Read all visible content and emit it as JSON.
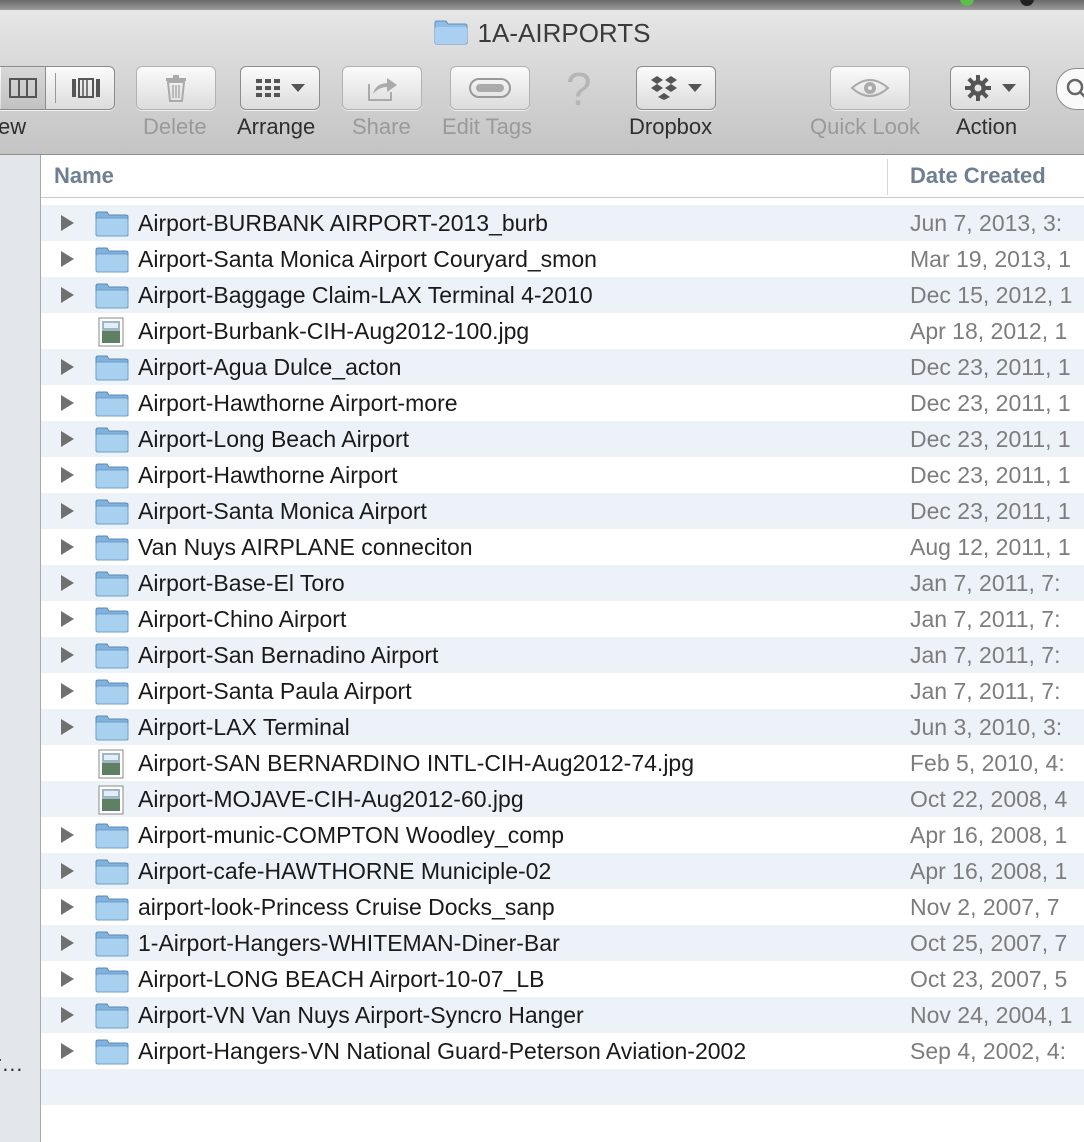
{
  "window": {
    "title": "1A-AIRPORTS"
  },
  "toolbar": {
    "view_label_partial": "ew",
    "delete_label": "Delete",
    "arrange_label": "Arrange",
    "share_label": "Share",
    "edit_tags_label": "Edit Tags",
    "help_glyph": "?",
    "dropbox_label": "Dropbox",
    "quick_look_label": "Quick Look",
    "action_label": "Action"
  },
  "sidebar": {
    "truncated_item": "r…"
  },
  "columns": {
    "name": "Name",
    "date_created": "Date Created"
  },
  "files": [
    {
      "name": "Airport-BURBANK AIRPORT-2013_burb",
      "date": "Jun 7, 2013, 3:",
      "type": "folder"
    },
    {
      "name": "Airport-Santa Monica Airport Couryard_smon",
      "date": "Mar 19, 2013, 1",
      "type": "folder"
    },
    {
      "name": "Airport-Baggage Claim-LAX Terminal 4-2010",
      "date": "Dec 15, 2012, 1",
      "type": "folder"
    },
    {
      "name": "Airport-Burbank-CIH-Aug2012-100.jpg",
      "date": "Apr 18, 2012, 1",
      "type": "image"
    },
    {
      "name": "Airport-Agua Dulce_acton",
      "date": "Dec 23, 2011, 1",
      "type": "folder"
    },
    {
      "name": "Airport-Hawthorne Airport-more",
      "date": "Dec 23, 2011, 1",
      "type": "folder"
    },
    {
      "name": "Airport-Long Beach Airport",
      "date": "Dec 23, 2011, 1",
      "type": "folder"
    },
    {
      "name": "Airport-Hawthorne Airport",
      "date": "Dec 23, 2011, 1",
      "type": "folder"
    },
    {
      "name": "Airport-Santa Monica Airport",
      "date": "Dec 23, 2011, 1",
      "type": "folder"
    },
    {
      "name": "Van Nuys AIRPLANE conneciton",
      "date": "Aug 12, 2011, 1",
      "type": "folder"
    },
    {
      "name": "Airport-Base-El Toro",
      "date": "Jan 7, 2011, 7:",
      "type": "folder"
    },
    {
      "name": "Airport-Chino Airport",
      "date": "Jan 7, 2011, 7:",
      "type": "folder"
    },
    {
      "name": "Airport-San Bernadino Airport",
      "date": "Jan 7, 2011, 7:",
      "type": "folder"
    },
    {
      "name": "Airport-Santa Paula Airport",
      "date": "Jan 7, 2011, 7:",
      "type": "folder"
    },
    {
      "name": "Airport-LAX Terminal",
      "date": "Jun 3, 2010, 3:",
      "type": "folder"
    },
    {
      "name": "Airport-SAN BERNARDINO INTL-CIH-Aug2012-74.jpg",
      "date": "Feb 5, 2010, 4:",
      "type": "image"
    },
    {
      "name": "Airport-MOJAVE-CIH-Aug2012-60.jpg",
      "date": "Oct 22, 2008, 4",
      "type": "image"
    },
    {
      "name": "Airport-munic-COMPTON Woodley_comp",
      "date": "Apr 16, 2008, 1",
      "type": "folder"
    },
    {
      "name": "Airport-cafe-HAWTHORNE Municiple-02",
      "date": "Apr 16, 2008, 1",
      "type": "folder"
    },
    {
      "name": "airport-look-Princess Cruise Docks_sanp",
      "date": "Nov 2, 2007, 7",
      "type": "folder"
    },
    {
      "name": "1-Airport-Hangers-WHITEMAN-Diner-Bar",
      "date": "Oct 25, 2007, 7",
      "type": "folder"
    },
    {
      "name": "Airport-LONG BEACH Airport-10-07_LB",
      "date": "Oct 23, 2007, 5",
      "type": "folder"
    },
    {
      "name": "Airport-VN Van Nuys Airport-Syncro Hanger",
      "date": "Nov 24, 2004, 1",
      "type": "folder"
    },
    {
      "name": "Airport-Hangers-VN National Guard-Peterson Aviation-2002",
      "date": "Sep 4, 2002, 4:",
      "type": "folder"
    }
  ],
  "colors": {
    "row_stripe": "#edf2f8",
    "header_text": "#6f7f92",
    "folder_blue": "#9ec8ea",
    "date_text": "#7d7d7d"
  }
}
